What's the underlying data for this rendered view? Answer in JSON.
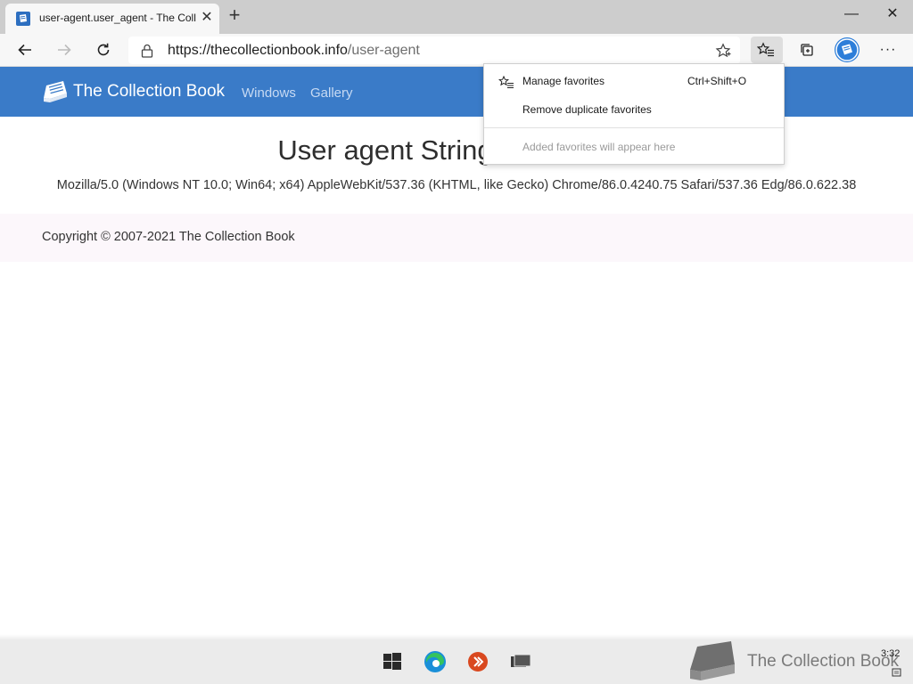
{
  "browser": {
    "tab": {
      "title": "user-agent.user_agent - The Coll",
      "close_glyph": "✕"
    },
    "new_tab_glyph": "+",
    "window_buttons": {
      "minimize": "—",
      "close": "✕"
    },
    "address": {
      "domain": "https://thecollectionbook.info",
      "path": "/user-agent"
    },
    "more_glyph": "···"
  },
  "site": {
    "brand": "The Collection Book",
    "nav": [
      "Windows",
      "Gallery"
    ],
    "title": "User agent String",
    "user_agent": "Mozilla/5.0 (Windows NT 10.0; Win64; x64) AppleWebKit/537.36 (KHTML, like Gecko) Chrome/86.0.4240.75 Safari/537.36 Edg/86.0.622.38",
    "copyright": "Copyright © 2007-2021 The Collection Book"
  },
  "favorites_menu": {
    "manage": {
      "label": "Manage favorites",
      "shortcut": "Ctrl+Shift+O"
    },
    "remove_duplicates": {
      "label": "Remove duplicate favorites"
    },
    "empty_message": "Added favorites will appear here"
  },
  "taskbar": {
    "watermark": "The Collection Book",
    "clock": "3:32"
  },
  "colors": {
    "header": "#3a7bc8",
    "accent": "#2d7ed9",
    "edge": "#1a8fd8"
  }
}
